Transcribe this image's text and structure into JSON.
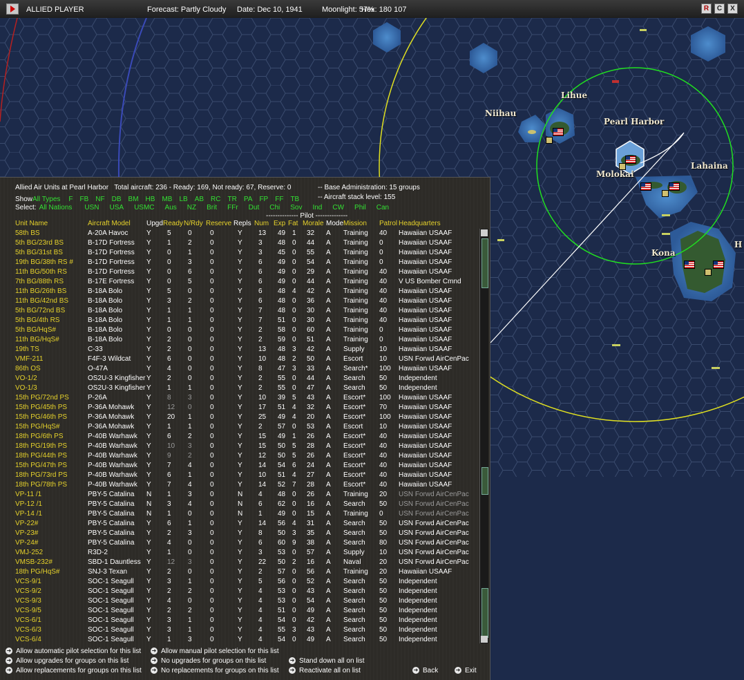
{
  "topbar": {
    "player": "ALLIED PLAYER",
    "forecast": "Forecast: Partly Cloudy",
    "date": "Date: Dec 10, 1941",
    "moonlight": "Moonlight: 57%",
    "hex": "Hex: 180 107",
    "buttons": [
      "R",
      "C",
      "X"
    ]
  },
  "map": {
    "labels": {
      "lihue": "Lihue",
      "niihau": "Niihau",
      "pearl_harbor": "Pearl Harbor",
      "molokai": "Molokai",
      "lahaina": "Lahaina",
      "kona": "Kona",
      "edge": "H"
    },
    "colors": {
      "ocean": "#1c2a4a",
      "shallow": "#3e78b8",
      "land": "#345a30",
      "range_green": "#20e020",
      "range_yellow": "#e0e020"
    }
  },
  "panel": {
    "header": {
      "title": "Allied Air Units at Pearl Harbor",
      "total": "Total aircraft: 236 - Ready: 169, Not ready: 67, Reserve: 0",
      "base_admin": "-- Base Administration: 15 groups",
      "stack_level": "-- Aircraft stack level: 155"
    },
    "show_label": "Show",
    "show_types": [
      "All Types",
      "F",
      "FB",
      "NF",
      "DB",
      "BM",
      "HB",
      "MB",
      "LB",
      "AB",
      "RC",
      "TR",
      "PA",
      "FP",
      "FF",
      "TB"
    ],
    "select_label": "Select:",
    "nations": [
      "All Nations",
      "USN",
      "USA",
      "USMC",
      "Aus",
      "NZ",
      "Brit",
      "FFr",
      "Dut",
      "Chi",
      "Sov",
      "Ind",
      "CW",
      "Phil",
      "Can"
    ],
    "pilot_divider": "-------------- Pilot --------------",
    "columns": [
      "Unit Name",
      "Aircraft Model",
      "Upgd",
      "Ready",
      "N/Rdy",
      "Reserve",
      "Repls",
      "Num",
      "Exp",
      "Fat",
      "Morale",
      "Mode",
      "Mission",
      "Patrol",
      "Headquarters"
    ],
    "rows": [
      [
        "58th BS",
        "A-20A Havoc",
        "Y",
        "5",
        "0",
        "0",
        "Y",
        "13",
        "49",
        "1",
        "32",
        "A",
        "Training",
        "40",
        "Hawaiian USAAF"
      ],
      [
        "5th BG/23rd BS",
        "B-17D Fortress",
        "Y",
        "1",
        "2",
        "0",
        "Y",
        "3",
        "48",
        "0",
        "44",
        "A",
        "Training",
        "0",
        "Hawaiian USAAF"
      ],
      [
        "5th BG/31st BS",
        "B-17D Fortress",
        "Y",
        "0",
        "1",
        "0",
        "Y",
        "3",
        "45",
        "0",
        "55",
        "A",
        "Training",
        "0",
        "Hawaiian USAAF"
      ],
      [
        "19th BG/38th RS #",
        "B-17D Fortress",
        "Y",
        "0",
        "3",
        "0",
        "Y",
        "6",
        "49",
        "0",
        "54",
        "A",
        "Training",
        "0",
        "Hawaiian USAAF"
      ],
      [
        "11th BG/50th RS",
        "B-17D Fortress",
        "Y",
        "0",
        "6",
        "0",
        "Y",
        "6",
        "49",
        "0",
        "29",
        "A",
        "Training",
        "40",
        "Hawaiian USAAF"
      ],
      [
        "7th BG/88th RS",
        "B-17E Fortress",
        "Y",
        "0",
        "5",
        "0",
        "Y",
        "6",
        "49",
        "0",
        "44",
        "A",
        "Training",
        "40",
        "V US Bomber Cmnd"
      ],
      [
        "11th BG/26th BS",
        "B-18A Bolo",
        "Y",
        "5",
        "0",
        "0",
        "Y",
        "6",
        "48",
        "4",
        "42",
        "A",
        "Training",
        "40",
        "Hawaiian USAAF"
      ],
      [
        "11th BG/42nd BS",
        "B-18A Bolo",
        "Y",
        "3",
        "2",
        "0",
        "Y",
        "6",
        "48",
        "0",
        "36",
        "A",
        "Training",
        "40",
        "Hawaiian USAAF"
      ],
      [
        "5th BG/72nd BS",
        "B-18A Bolo",
        "Y",
        "1",
        "1",
        "0",
        "Y",
        "7",
        "48",
        "0",
        "30",
        "A",
        "Training",
        "40",
        "Hawaiian USAAF"
      ],
      [
        "5th BG/4th RS",
        "B-18A Bolo",
        "Y",
        "1",
        "1",
        "0",
        "Y",
        "7",
        "51",
        "0",
        "30",
        "A",
        "Training",
        "40",
        "Hawaiian USAAF"
      ],
      [
        "5th BG/HqS#",
        "B-18A Bolo",
        "Y",
        "0",
        "0",
        "0",
        "Y",
        "2",
        "58",
        "0",
        "60",
        "A",
        "Training",
        "0",
        "Hawaiian USAAF"
      ],
      [
        "11th BG/HqS#",
        "B-18A Bolo",
        "Y",
        "2",
        "0",
        "0",
        "Y",
        "2",
        "59",
        "0",
        "51",
        "A",
        "Training",
        "0",
        "Hawaiian USAAF"
      ],
      [
        "19th TS",
        "C-33",
        "Y",
        "2",
        "0",
        "0",
        "Y",
        "13",
        "48",
        "3",
        "42",
        "A",
        "Supply",
        "10",
        "Hawaiian USAAF"
      ],
      [
        "VMF-211",
        "F4F-3 Wildcat",
        "Y",
        "6",
        "0",
        "0",
        "Y",
        "10",
        "48",
        "2",
        "50",
        "A",
        "Escort",
        "10",
        "USN Forwd AirCenPac"
      ],
      [
        "86th OS",
        "O-47A",
        "Y",
        "4",
        "0",
        "0",
        "Y",
        "8",
        "47",
        "3",
        "33",
        "A",
        "Search*",
        "100",
        "Hawaiian USAAF"
      ],
      [
        "VO-1/2",
        "OS2U-3 Kingfisher",
        "Y",
        "2",
        "0",
        "0",
        "Y",
        "2",
        "55",
        "0",
        "44",
        "A",
        "Search",
        "50",
        "Independent"
      ],
      [
        "VO-1/3",
        "OS2U-3 Kingfisher",
        "Y",
        "1",
        "1",
        "0",
        "Y",
        "2",
        "55",
        "0",
        "47",
        "A",
        "Search",
        "50",
        "Independent"
      ],
      [
        "15th PG/72nd PS",
        "P-26A",
        "Y",
        "8",
        "3",
        "0",
        "Y",
        "10",
        "39",
        "5",
        "43",
        "A",
        "Escort*",
        "100",
        "Hawaiian USAAF"
      ],
      [
        "15th PG/45th PS",
        "P-36A Mohawk",
        "Y",
        "12",
        "0",
        "0",
        "Y",
        "17",
        "51",
        "4",
        "32",
        "A",
        "Escort*",
        "70",
        "Hawaiian USAAF"
      ],
      [
        "15th PG/46th PS",
        "P-36A Mohawk",
        "Y",
        "20",
        "1",
        "0",
        "Y",
        "25",
        "49",
        "4",
        "20",
        "A",
        "Escort*",
        "100",
        "Hawaiian USAAF"
      ],
      [
        "15th PG/HqS#",
        "P-36A Mohawk",
        "Y",
        "1",
        "1",
        "0",
        "Y",
        "2",
        "57",
        "0",
        "53",
        "A",
        "Escort",
        "10",
        "Hawaiian USAAF"
      ],
      [
        "18th PG/6th PS",
        "P-40B Warhawk",
        "Y",
        "6",
        "2",
        "0",
        "Y",
        "15",
        "49",
        "1",
        "26",
        "A",
        "Escort*",
        "40",
        "Hawaiian USAAF"
      ],
      [
        "18th PG/19th PS",
        "P-40B Warhawk",
        "Y",
        "10",
        "3",
        "0",
        "Y",
        "15",
        "50",
        "5",
        "28",
        "A",
        "Escort*",
        "40",
        "Hawaiian USAAF"
      ],
      [
        "18th PG/44th PS",
        "P-40B Warhawk",
        "Y",
        "9",
        "2",
        "0",
        "Y",
        "12",
        "50",
        "5",
        "26",
        "A",
        "Escort*",
        "40",
        "Hawaiian USAAF"
      ],
      [
        "15th PG/47th PS",
        "P-40B Warhawk",
        "Y",
        "7",
        "4",
        "0",
        "Y",
        "14",
        "54",
        "6",
        "24",
        "A",
        "Escort*",
        "40",
        "Hawaiian USAAF"
      ],
      [
        "18th PG/73rd PS",
        "P-40B Warhawk",
        "Y",
        "6",
        "1",
        "0",
        "Y",
        "10",
        "51",
        "4",
        "27",
        "A",
        "Escort*",
        "40",
        "Hawaiian USAAF"
      ],
      [
        "18th PG/78th PS",
        "P-40B Warhawk",
        "Y",
        "7",
        "4",
        "0",
        "Y",
        "14",
        "52",
        "7",
        "28",
        "A",
        "Escort*",
        "40",
        "Hawaiian USAAF"
      ],
      [
        "VP-11 /1",
        "PBY-5 Catalina",
        "N",
        "1",
        "3",
        "0",
        "N",
        "4",
        "48",
        "0",
        "26",
        "A",
        "Training",
        "20",
        "USN Forwd AirCenPac"
      ],
      [
        "VP-12 /1",
        "PBY-5 Catalina",
        "N",
        "3",
        "4",
        "0",
        "N",
        "6",
        "62",
        "0",
        "16",
        "A",
        "Search",
        "50",
        "USN Forwd AirCenPac"
      ],
      [
        "VP-14 /1",
        "PBY-5 Catalina",
        "N",
        "1",
        "0",
        "0",
        "N",
        "1",
        "49",
        "0",
        "15",
        "A",
        "Training",
        "0",
        "USN Forwd AirCenPac"
      ],
      [
        "VP-22#",
        "PBY-5 Catalina",
        "Y",
        "6",
        "1",
        "0",
        "Y",
        "14",
        "56",
        "4",
        "31",
        "A",
        "Search",
        "50",
        "USN Forwd AirCenPac"
      ],
      [
        "VP-23#",
        "PBY-5 Catalina",
        "Y",
        "2",
        "3",
        "0",
        "Y",
        "8",
        "50",
        "3",
        "35",
        "A",
        "Search",
        "50",
        "USN Forwd AirCenPac"
      ],
      [
        "VP-24#",
        "PBY-5 Catalina",
        "Y",
        "4",
        "0",
        "0",
        "Y",
        "6",
        "60",
        "9",
        "38",
        "A",
        "Search",
        "80",
        "USN Forwd AirCenPac"
      ],
      [
        "VMJ-252",
        "R3D-2",
        "Y",
        "1",
        "0",
        "0",
        "Y",
        "3",
        "53",
        "0",
        "57",
        "A",
        "Supply",
        "10",
        "USN Forwd AirCenPac"
      ],
      [
        "VMSB-232#",
        "SBD-1 Dauntless",
        "Y",
        "12",
        "3",
        "0",
        "Y",
        "22",
        "50",
        "2",
        "16",
        "A",
        "Naval",
        "20",
        "USN Forwd AirCenPac"
      ],
      [
        "18th PG/HqS#",
        "SNJ-3 Texan",
        "Y",
        "2",
        "0",
        "0",
        "Y",
        "2",
        "57",
        "0",
        "56",
        "A",
        "Training",
        "20",
        "Hawaiian USAAF"
      ],
      [
        "VCS-9/1",
        "SOC-1 Seagull",
        "Y",
        "3",
        "1",
        "0",
        "Y",
        "5",
        "56",
        "0",
        "52",
        "A",
        "Search",
        "50",
        "Independent"
      ],
      [
        "VCS-9/2",
        "SOC-1 Seagull",
        "Y",
        "2",
        "2",
        "0",
        "Y",
        "4",
        "53",
        "0",
        "43",
        "A",
        "Search",
        "50",
        "Independent"
      ],
      [
        "VCS-9/3",
        "SOC-1 Seagull",
        "Y",
        "4",
        "0",
        "0",
        "Y",
        "4",
        "53",
        "0",
        "54",
        "A",
        "Search",
        "50",
        "Independent"
      ],
      [
        "VCS-9/5",
        "SOC-1 Seagull",
        "Y",
        "2",
        "2",
        "0",
        "Y",
        "4",
        "51",
        "0",
        "49",
        "A",
        "Search",
        "50",
        "Independent"
      ],
      [
        "VCS-6/1",
        "SOC-1 Seagull",
        "Y",
        "3",
        "1",
        "0",
        "Y",
        "4",
        "54",
        "0",
        "42",
        "A",
        "Search",
        "50",
        "Independent"
      ],
      [
        "VCS-6/3",
        "SOC-1 Seagull",
        "Y",
        "3",
        "1",
        "0",
        "Y",
        "4",
        "55",
        "3",
        "43",
        "A",
        "Search",
        "50",
        "Independent"
      ],
      [
        "VCS-6/4",
        "SOC-1 Seagull",
        "Y",
        "1",
        "3",
        "0",
        "Y",
        "4",
        "54",
        "0",
        "49",
        "A",
        "Search",
        "50",
        "Independent"
      ]
    ],
    "footer": {
      "auto_pilot": "Allow automatic pilot selection for this list",
      "manual_pilot": "Allow manual pilot selection for this list",
      "allow_upgrades": "Allow upgrades for groups on this list",
      "no_upgrades": "No upgrades for groups on this list",
      "stand_down": "Stand down all on list",
      "allow_repl": "Allow replacements for groups on this list",
      "no_repl": "No replacements for groups on this list",
      "reactivate": "Reactivate all on list",
      "back": "Back",
      "exit": "Exit"
    }
  }
}
